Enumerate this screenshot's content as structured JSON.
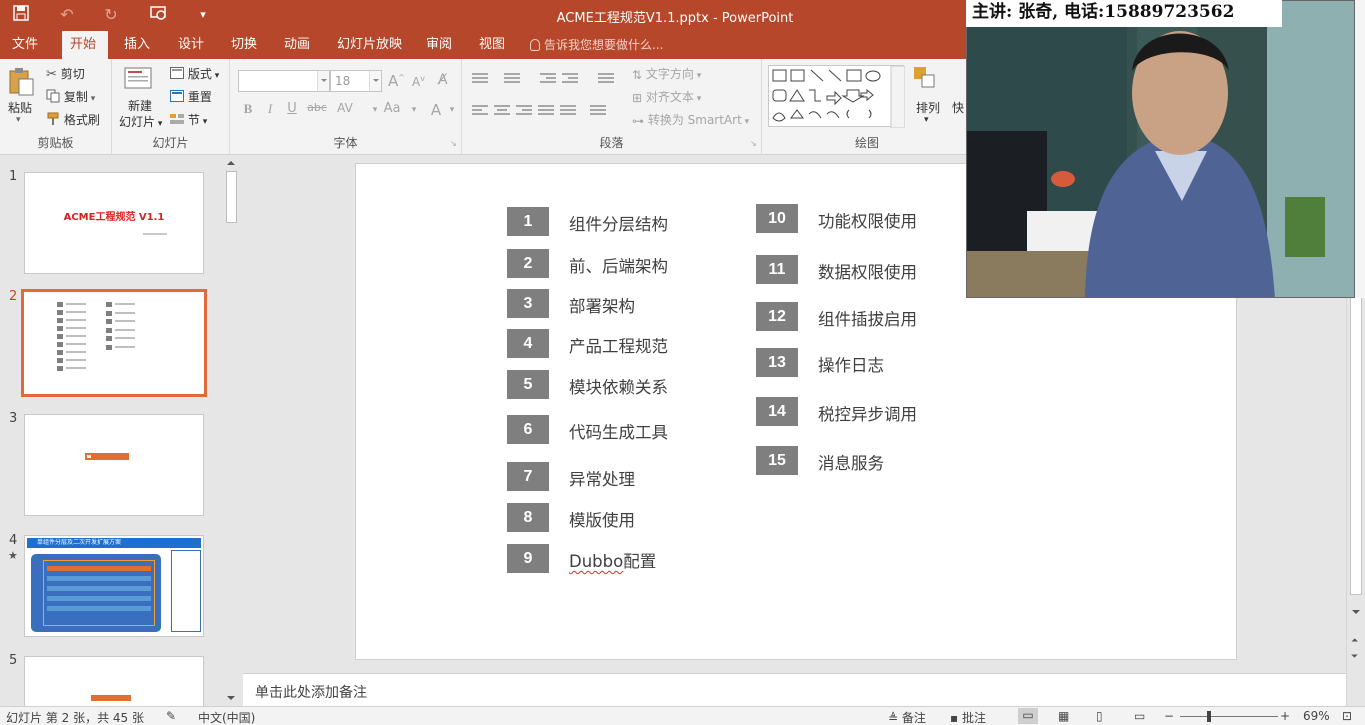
{
  "window": {
    "title": "ACME工程规范V1.1.pptx - PowerPoint"
  },
  "tabs": [
    "文件",
    "开始",
    "插入",
    "设计",
    "切换",
    "动画",
    "幻灯片放映",
    "审阅",
    "视图"
  ],
  "active_tab": "开始",
  "tell_me": "告诉我您想要做什么...",
  "ribbon": {
    "clipboard": {
      "paste": "粘贴",
      "cut": "剪切",
      "copy": "复制",
      "format_painter": "格式刷",
      "label": "剪贴板"
    },
    "slides": {
      "new_slide_1": "新建",
      "new_slide_2": "幻灯片",
      "layout": "版式",
      "reset": "重置",
      "section": "节",
      "label": "幻灯片"
    },
    "font": {
      "size": "18",
      "bold": "B",
      "italic": "I",
      "underline": "U",
      "strike": "abc",
      "spacing": "AV",
      "case": "Aa",
      "color": "A",
      "grow": "A",
      "shrink": "A",
      "label": "字体"
    },
    "paragraph": {
      "text_direction": "文字方向",
      "align_text": "对齐文本",
      "smartart": "转换为 SmartArt",
      "label": "段落"
    },
    "drawing": {
      "arrange": "排列",
      "quick": "快",
      "label": "绘图"
    }
  },
  "slides_panel": {
    "thumbs": [
      {
        "num": "1",
        "title": "ACME工程规范 V1.1"
      },
      {
        "num": "2"
      },
      {
        "num": "3"
      },
      {
        "num": "4",
        "star": "★",
        "header": "单组件分层及二次开发扩展方案"
      },
      {
        "num": "5"
      }
    ]
  },
  "slide": {
    "left_items": [
      {
        "num": "1",
        "label": "组件分层结构"
      },
      {
        "num": "2",
        "label": "前、后端架构"
      },
      {
        "num": "3",
        "label": "部署架构"
      },
      {
        "num": "4",
        "label": "产品工程规范"
      },
      {
        "num": "5",
        "label": "模块依赖关系"
      },
      {
        "num": "6",
        "label": "代码生成工具"
      },
      {
        "num": "7",
        "label": "异常处理"
      },
      {
        "num": "8",
        "label": "模版使用"
      },
      {
        "num": "9",
        "label_a": "Dubbo",
        "label_b": "配置"
      }
    ],
    "right_items": [
      {
        "num": "10",
        "label": "功能权限使用"
      },
      {
        "num": "11",
        "label": "数据权限使用"
      },
      {
        "num": "12",
        "label": "组件插拔启用"
      },
      {
        "num": "13",
        "label": "操作日志"
      },
      {
        "num": "14",
        "label": "税控异步调用"
      },
      {
        "num": "15",
        "label": "消息服务"
      }
    ]
  },
  "notes": {
    "placeholder": "单击此处添加备注"
  },
  "status": {
    "slide_info": "幻灯片 第 2 张，共 45 张",
    "language": "中文(中国)",
    "notes_btn": "备注",
    "comments_btn": "批注",
    "zoom": "69%"
  },
  "overlay": {
    "caption": "主讲: 张奇, 电话:15889723562"
  }
}
